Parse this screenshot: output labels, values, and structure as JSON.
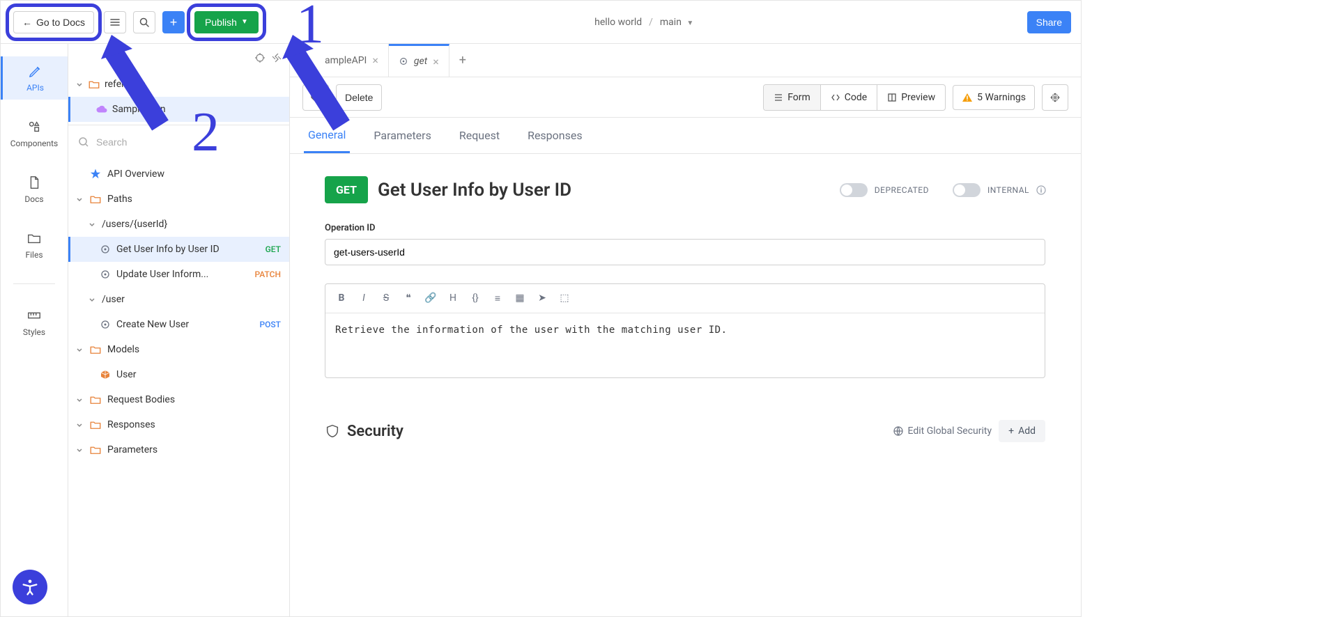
{
  "topbar": {
    "go_to_docs": "Go to Docs",
    "publish": "Publish",
    "share": "Share"
  },
  "breadcrumb": {
    "project": "hello world",
    "branch": "main"
  },
  "rail": {
    "apis": "APIs",
    "components": "Components",
    "docs": "Docs",
    "files": "Files",
    "styles": "Styles"
  },
  "sidebar": {
    "root_folder": "reference",
    "root_file": "SampleAPI.json",
    "root_file_visible": "Sample     json",
    "search_placeholder": "Search",
    "api_overview": "API Overview",
    "paths_label": "Paths",
    "path1": "/users/{userId}",
    "op1": "Get User Info by User ID",
    "op1_method": "GET",
    "op2": "Update User Inform...",
    "op2_method": "PATCH",
    "path2": "/user",
    "op3": "Create New User",
    "op3_method": "POST",
    "models_label": "Models",
    "model1": "User",
    "request_bodies": "Request Bodies",
    "responses": "Responses",
    "parameters": "Parameters"
  },
  "tabs": {
    "t1": "SampleAPI",
    "t1_visible": "ampleAPI",
    "t2": "get"
  },
  "actionbar": {
    "delete": "Delete",
    "form": "Form",
    "code": "Code",
    "preview": "Preview",
    "warnings": "5 Warnings"
  },
  "subtabs": {
    "general": "General",
    "parameters": "Parameters",
    "request": "Request",
    "responses": "Responses"
  },
  "endpoint": {
    "method": "GET",
    "title": "Get User Info by User ID",
    "deprecated_label": "DEPRECATED",
    "internal_label": "INTERNAL",
    "operation_id_label": "Operation ID",
    "operation_id_value": "get-users-userId",
    "description": "Retrieve the information of the user with the matching user ID."
  },
  "security": {
    "title": "Security",
    "edit_global": "Edit Global Security",
    "add": "Add"
  },
  "annotations": {
    "n1": "1",
    "n2": "2"
  }
}
